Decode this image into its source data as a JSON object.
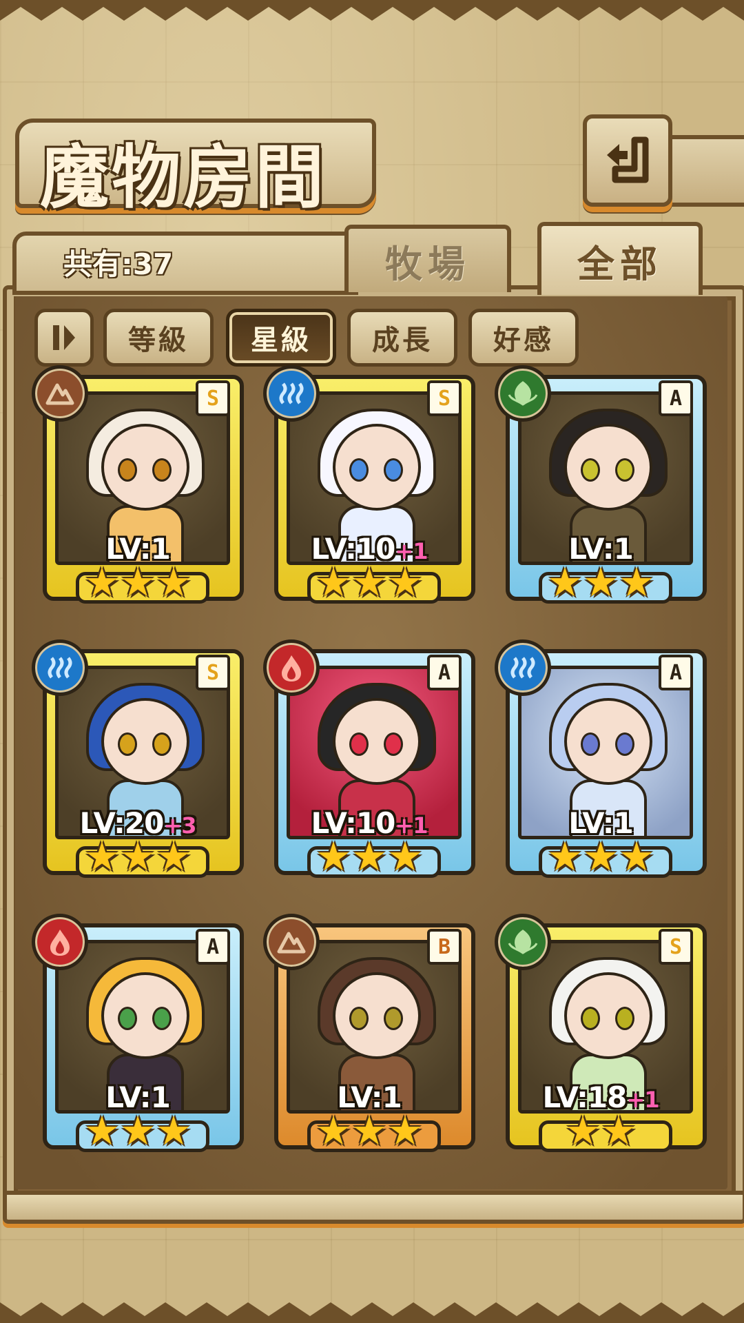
{
  "header": {
    "title": "魔物房間",
    "back_icon": "return-arrow-icon"
  },
  "summary": {
    "count_label": "共有:37"
  },
  "tabs": [
    {
      "label": "牧場",
      "selected": false
    },
    {
      "label": "全部",
      "selected": true
    }
  ],
  "sort": {
    "toggle_icon": "sort-order-icon",
    "buttons": [
      {
        "label": "等級",
        "active": false
      },
      {
        "label": "星級",
        "active": true
      },
      {
        "label": "成長",
        "active": false
      },
      {
        "label": "好感",
        "active": false
      }
    ]
  },
  "monsters": [
    {
      "element": "earth",
      "rank": "S",
      "level": "LV:1",
      "bonus": "",
      "stars": "★★★",
      "frame": "gold"
    },
    {
      "element": "water",
      "rank": "S",
      "level": "LV:10",
      "bonus": "+1",
      "stars": "★★★",
      "frame": "gold"
    },
    {
      "element": "nature",
      "rank": "A",
      "level": "LV:1",
      "bonus": "",
      "stars": "★★★",
      "frame": "blue"
    },
    {
      "element": "water",
      "rank": "S",
      "level": "LV:20",
      "bonus": "+3",
      "stars": "★★★",
      "frame": "gold"
    },
    {
      "element": "fire",
      "rank": "A",
      "level": "LV:10",
      "bonus": "+1",
      "stars": "★★★",
      "frame": "blue"
    },
    {
      "element": "water",
      "rank": "A",
      "level": "LV:1",
      "bonus": "",
      "stars": "★★★",
      "frame": "blue"
    },
    {
      "element": "fire",
      "rank": "A",
      "level": "LV:1",
      "bonus": "",
      "stars": "★★★",
      "frame": "blue"
    },
    {
      "element": "earth",
      "rank": "B",
      "level": "LV:1",
      "bonus": "",
      "stars": "★★★",
      "frame": "bronze"
    },
    {
      "element": "nature",
      "rank": "S",
      "level": "LV:18",
      "bonus": "+1",
      "stars": "★★",
      "frame": "gold"
    }
  ],
  "colors": {
    "frame_gold": "#f4d63a",
    "frame_blue": "#a6dcf2",
    "frame_bronze": "#ec9c3e",
    "bonus_pink": "#ff5fb0",
    "star_yellow": "#ffc71a",
    "outline_brown": "#6d5029"
  }
}
